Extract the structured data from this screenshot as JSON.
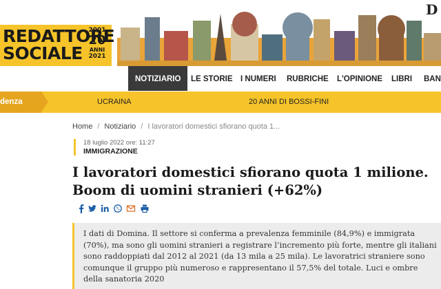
{
  "header": {
    "logo_line1": "REDATTORE",
    "logo_line2": "SOCIALE",
    "anni_year_from": "2001",
    "anni_number": "20",
    "anni_word": "ANNI",
    "anni_year_to": "2021",
    "brand_color": "#f6c42a"
  },
  "nav": {
    "items": [
      "NOTIZIARIO",
      "LE STORIE",
      "I NUMERI",
      "RUBRICHE",
      "L'OPINIONE",
      "LIBRI",
      "BANC"
    ],
    "active_index": 0
  },
  "ticker": {
    "highlight": "denza",
    "items": [
      "UCRAINA",
      "20 ANNI DI BOSSI-FINI"
    ]
  },
  "breadcrumb": {
    "home": "Home",
    "section": "Notiziario",
    "current": "I lavoratori domestici sfiorano quota 1..."
  },
  "article": {
    "date": "18 luglio 2022 ore: 11:27",
    "category": "IMMIGRAZIONE",
    "title": "I lavoratori domestici sfiorano quota 1 milione. Boom di uomini stranieri (+62%)",
    "summary": "I dati di Domina. Il settore si conferma a prevalenza femminile (84,9%) e immigrata (70%), ma sono gli uomini stranieri a registrare l’incremento più forte, mentre gli italiani sono raddoppiati dal 2012 al 2021 (da 13 mila a 25 mila). Le lavoratrici straniere sono comunque il gruppo più numeroso e rappresentano il 57,5% del totale. Luci e ombre della sanatoria 2020"
  },
  "share": {
    "icons": [
      "facebook-icon",
      "twitter-icon",
      "linkedin-icon",
      "whatsapp-icon",
      "email-icon",
      "print-icon"
    ],
    "color": "#1d5fa8"
  }
}
